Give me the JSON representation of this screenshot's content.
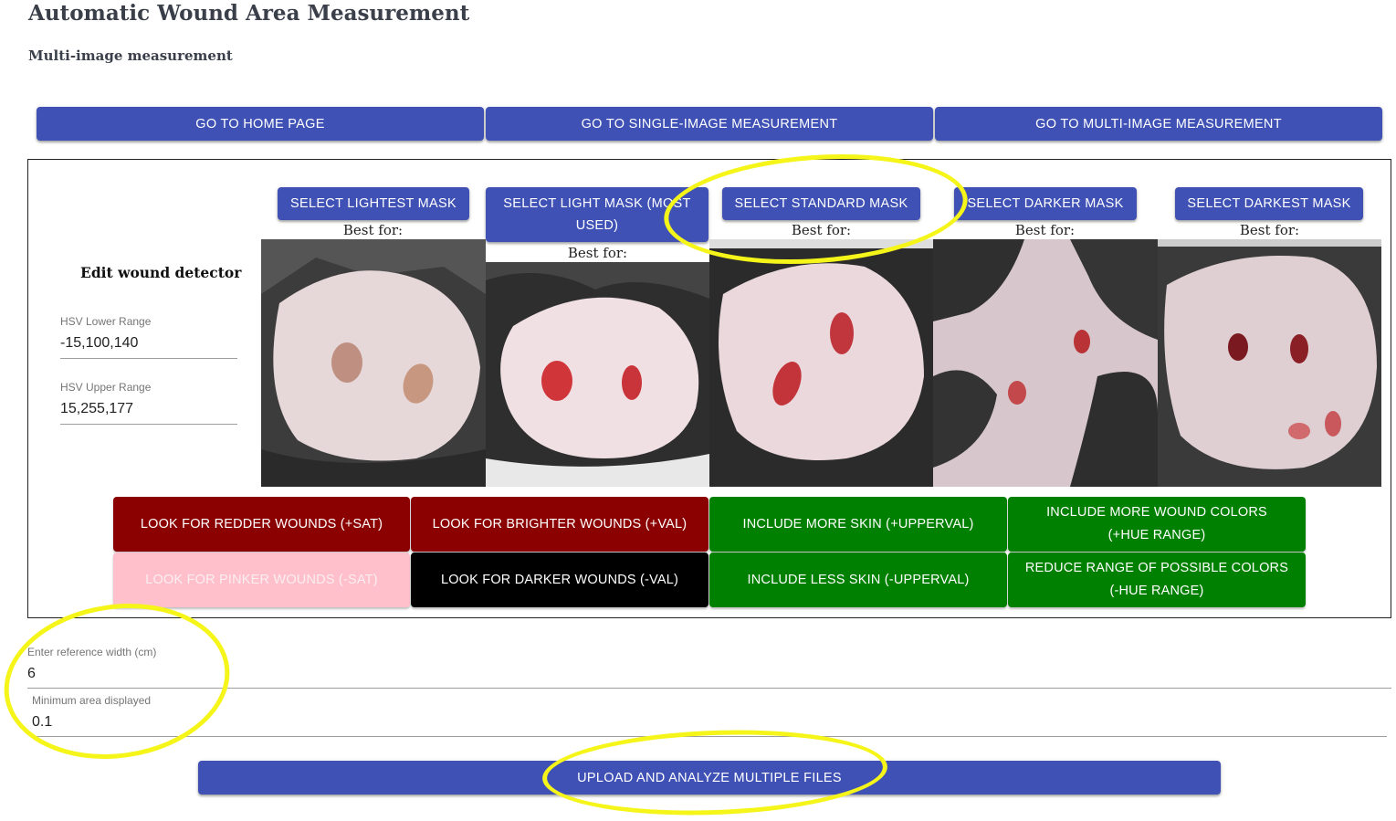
{
  "header": {
    "title": "Automatic Wound Area Measurement",
    "subtitle": "Multi-image measurement"
  },
  "nav": {
    "home": "GO TO HOME PAGE",
    "single": "GO TO SINGLE-IMAGE MEASUREMENT",
    "multi": "GO TO MULTI-IMAGE MEASUREMENT"
  },
  "masks": [
    {
      "label": "SELECT LIGHTEST MASK",
      "best_for": "Best for:"
    },
    {
      "label": "SELECT LIGHT MASK (MOST USED)",
      "best_for": "Best for:"
    },
    {
      "label": "SELECT STANDARD MASK",
      "best_for": "Best for:"
    },
    {
      "label": "SELECT DARKER MASK",
      "best_for": "Best for:"
    },
    {
      "label": "SELECT DARKEST MASK",
      "best_for": "Best for:"
    }
  ],
  "detector": {
    "title": "Edit wound detector",
    "hsv_lower_label": "HSV Lower Range",
    "hsv_lower_value": "-15,100,140",
    "hsv_upper_label": "HSV Upper Range",
    "hsv_upper_value": "15,255,177"
  },
  "adjust_buttons": {
    "redder": "LOOK FOR REDDER WOUNDS (+SAT)",
    "brighter": "LOOK FOR BRIGHTER WOUNDS (+VAL)",
    "more_skin": "INCLUDE MORE SKIN (+UPPERVAL)",
    "more_colors": "INCLUDE MORE WOUND COLORS (+HUE RANGE)",
    "pinker": "LOOK FOR PINKER WOUNDS (-SAT)",
    "darker": "LOOK FOR DARKER WOUNDS (-VAL)",
    "less_skin": "INCLUDE LESS SKIN (-UPPERVAL)",
    "reduce_colors": "REDUCE RANGE OF POSSIBLE COLORS (-HUE RANGE)"
  },
  "colors": {
    "primary": "#3f51b5",
    "dark_red": "#8b0000",
    "pink": "#ffc0cb",
    "black": "#000000",
    "green": "#008000",
    "highlight": "#f5f51a"
  },
  "reference": {
    "width_label": "Enter reference width (cm)",
    "width_value": "6",
    "min_area_label": "Minimum area displayed",
    "min_area_value": "0.1"
  },
  "upload": {
    "label": "UPLOAD AND ANALYZE MULTIPLE FILES"
  }
}
